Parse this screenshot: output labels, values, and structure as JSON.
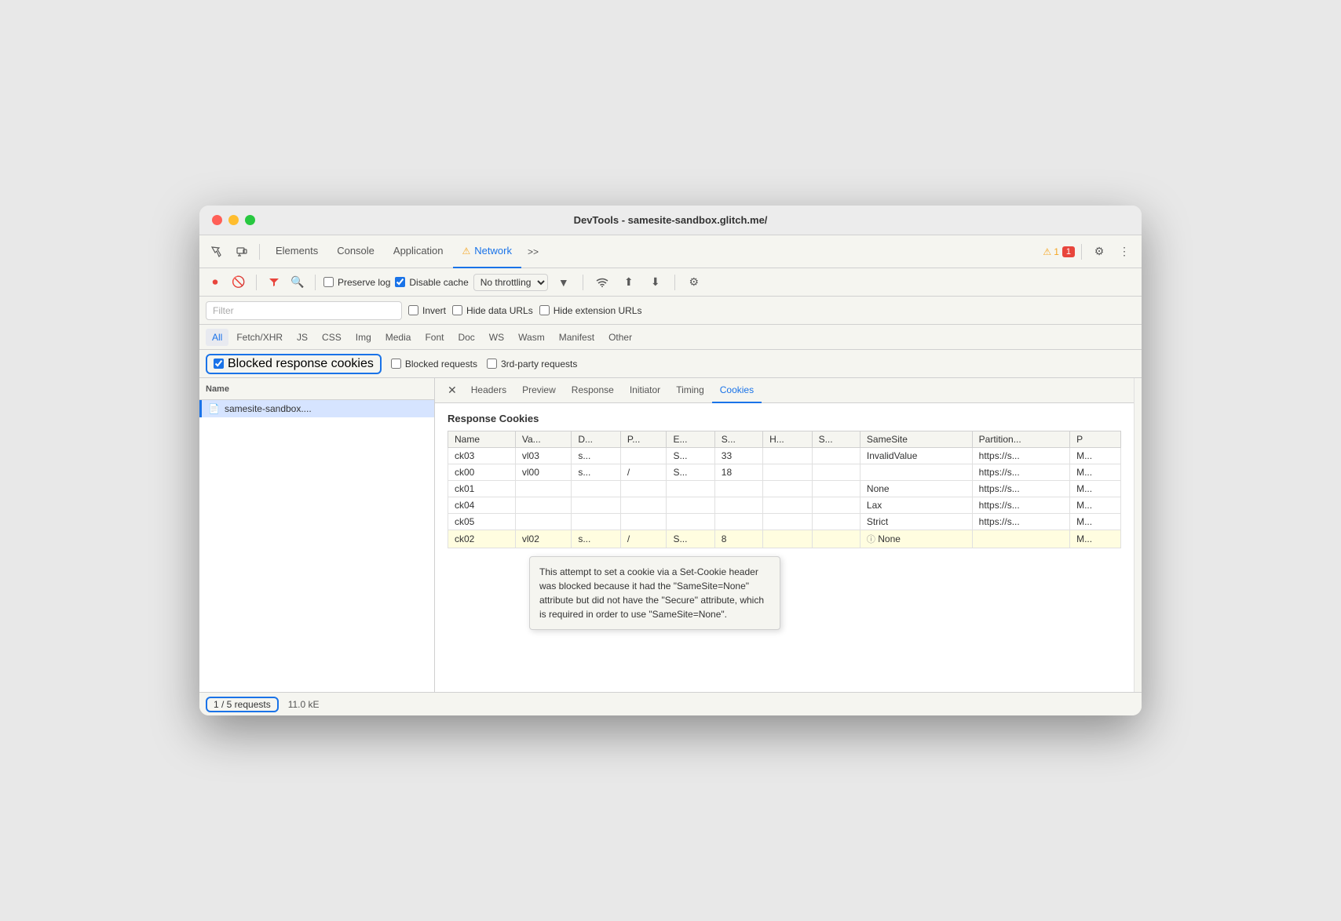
{
  "window": {
    "title": "DevTools - samesite-sandbox.glitch.me/"
  },
  "tabs": {
    "items": [
      {
        "label": "Elements",
        "active": false
      },
      {
        "label": "Console",
        "active": false
      },
      {
        "label": "Application",
        "active": false
      },
      {
        "label": "Network",
        "active": true,
        "warning": true
      },
      {
        "label": ">>",
        "more": true
      }
    ]
  },
  "toolbar": {
    "preserve_log": "Preserve log",
    "disable_cache": "Disable cache",
    "throttle": "No throttling",
    "filter_placeholder": "Filter",
    "invert": "Invert",
    "hide_data_urls": "Hide data URLs",
    "hide_ext_urls": "Hide extension URLs"
  },
  "resource_types": [
    "All",
    "Fetch/XHR",
    "JS",
    "CSS",
    "Img",
    "Media",
    "Font",
    "Doc",
    "WS",
    "Wasm",
    "Manifest",
    "Other"
  ],
  "cookie_filters": {
    "blocked_response": "Blocked response cookies",
    "blocked_requests": "Blocked requests",
    "third_party": "3rd-party requests"
  },
  "requests_panel": {
    "header": "Name",
    "items": [
      {
        "icon": "📄",
        "name": "samesite-sandbox...."
      }
    ]
  },
  "detail_tabs": [
    "Headers",
    "Preview",
    "Response",
    "Initiator",
    "Timing",
    "Cookies"
  ],
  "cookies_section": {
    "title": "Response Cookies",
    "columns": [
      "Name",
      "Va...",
      "D...",
      "P...",
      "E...",
      "S...",
      "H...",
      "S...",
      "SameSite",
      "Partition...",
      "P"
    ],
    "rows": [
      {
        "name": "ck03",
        "value": "vl03",
        "domain": "s...",
        "path": "",
        "expires": "S...",
        "size": "33",
        "httponly": "",
        "secure": "",
        "samesite": "InvalidValue",
        "partition": "https://s...",
        "priority": "M...",
        "highlighted": false
      },
      {
        "name": "ck00",
        "value": "vl00",
        "domain": "s...",
        "path": "/",
        "expires": "S...",
        "size": "18",
        "httponly": "",
        "secure": "",
        "samesite": "",
        "partition": "https://s...",
        "priority": "M...",
        "highlighted": false
      },
      {
        "name": "ck01",
        "value": "",
        "domain": "",
        "path": "",
        "expires": "",
        "size": "",
        "httponly": "",
        "secure": "",
        "samesite": "None",
        "partition": "https://s...",
        "priority": "M...",
        "highlighted": false
      },
      {
        "name": "ck04",
        "value": "",
        "domain": "",
        "path": "",
        "expires": "",
        "size": "",
        "httponly": "",
        "secure": "",
        "samesite": "Lax",
        "partition": "https://s...",
        "priority": "M...",
        "highlighted": false
      },
      {
        "name": "ck05",
        "value": "",
        "domain": "",
        "path": "",
        "expires": "",
        "size": "",
        "httponly": "",
        "secure": "",
        "samesite": "Strict",
        "partition": "https://s...",
        "priority": "M...",
        "highlighted": false
      },
      {
        "name": "ck02",
        "value": "vl02",
        "domain": "s...",
        "path": "/",
        "expires": "S...",
        "size": "8",
        "httponly": "",
        "secure": "",
        "samesite": "None",
        "partition": "",
        "priority": "M...",
        "highlighted": true,
        "info": true
      }
    ]
  },
  "tooltip": {
    "text": "This attempt to set a cookie via a Set-Cookie header was blocked because it had the \"SameSite=None\" attribute but did not have the \"Secure\" attribute, which is required in order to use \"SameSite=None\"."
  },
  "status_bar": {
    "requests": "1 / 5 requests",
    "size": "11.0 kE"
  },
  "badges": {
    "warning_count": "1",
    "error_count": "1"
  }
}
